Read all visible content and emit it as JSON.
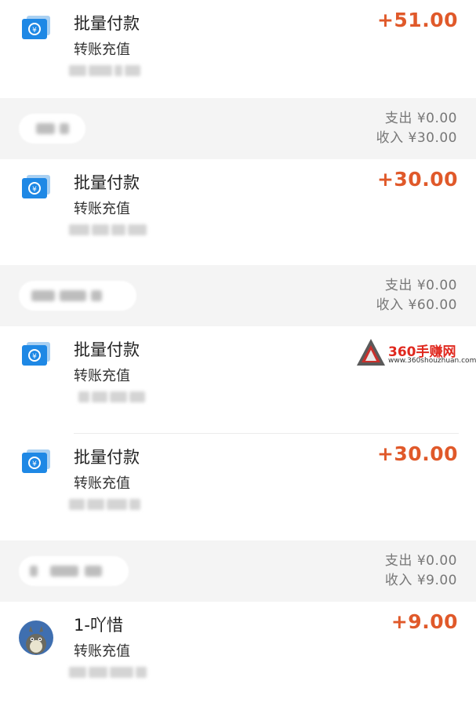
{
  "transactions": [
    {
      "title": "批量付款",
      "type": "转账充值",
      "amount": "+51.00",
      "icon": "transfer-card-icon"
    },
    {
      "title": "批量付款",
      "type": "转账充值",
      "amount": "+30.00",
      "icon": "transfer-card-icon"
    },
    {
      "title": "批量付款",
      "type": "转账充值",
      "amount": "",
      "icon": "transfer-card-icon"
    },
    {
      "title": "批量付款",
      "type": "转账充值",
      "amount": "+30.00",
      "icon": "transfer-card-icon"
    },
    {
      "title": "1-吖惜",
      "type": "转账充值",
      "amount": "+9.00",
      "icon": "avatar"
    }
  ],
  "headers": [
    {
      "expense": "支出 ¥0.00",
      "income": "收入 ¥30.00"
    },
    {
      "expense": "支出 ¥0.00",
      "income": "收入 ¥60.00"
    },
    {
      "expense": "支出 ¥0.00",
      "income": "收入 ¥9.00"
    }
  ],
  "watermark": {
    "text": "360手赚网",
    "url": "www.360shouzhuan.com"
  },
  "colors": {
    "amount": "#e0592a",
    "icon_blue": "#1e88e5",
    "section_bg": "#f4f4f4"
  }
}
